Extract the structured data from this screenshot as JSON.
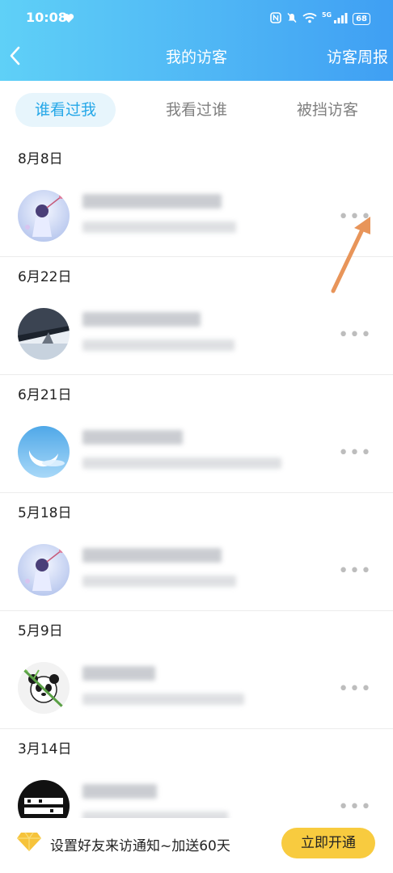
{
  "status_bar": {
    "time": "10:08",
    "network": "5G",
    "battery": "68"
  },
  "nav": {
    "title": "我的访客",
    "right_action": "访客周报"
  },
  "tabs": [
    {
      "label": "谁看过我",
      "active": true
    },
    {
      "label": "我看过谁",
      "active": false
    },
    {
      "label": "被挡访客",
      "active": false
    }
  ],
  "visitors": [
    {
      "date": "8月8日",
      "avatar": "anime-girl-avatar"
    },
    {
      "date": "6月22日",
      "avatar": "bridge-photo-avatar"
    },
    {
      "date": "6月21日",
      "avatar": "sky-moon-avatar"
    },
    {
      "date": "5月18日",
      "avatar": "anime-girl-avatar"
    },
    {
      "date": "5月9日",
      "avatar": "panda-avatar"
    },
    {
      "date": "3月14日",
      "avatar": "text-sticker-avatar"
    }
  ],
  "more_label": "•••",
  "promo": {
    "text": "设置好友来访通知~加送60天",
    "button": "立即开通"
  },
  "colors": {
    "header_start": "#5fd0f7",
    "header_end": "#3f9ff3",
    "active_tab": "#26a8e8",
    "promo_button": "#f8cb3f",
    "arrow": "#e8955a"
  }
}
